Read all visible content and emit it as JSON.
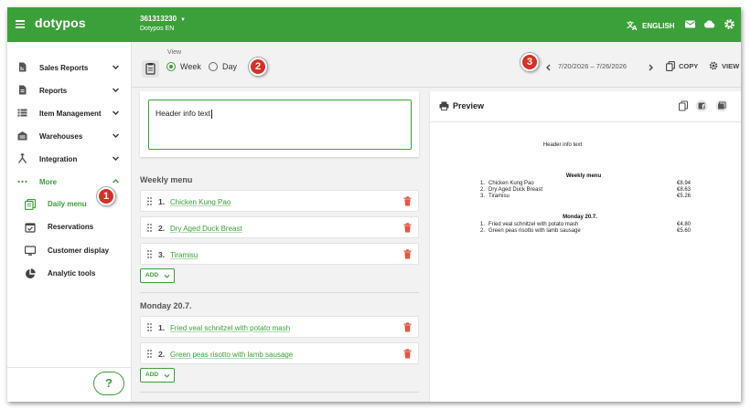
{
  "topbar": {
    "logo": "dotypos",
    "account_id": "361313230",
    "account_name": "Dotypos EN",
    "language": "ENGLISH",
    "color": "#3ba03a"
  },
  "sidebar": {
    "items": [
      {
        "label": "Sales Reports",
        "icon": "sales-report-icon"
      },
      {
        "label": "Reports",
        "icon": "report-icon"
      },
      {
        "label": "Item Management",
        "icon": "list-icon"
      },
      {
        "label": "Warehouses",
        "icon": "warehouse-icon"
      },
      {
        "label": "Integration",
        "icon": "integration-icon"
      },
      {
        "label": "More",
        "icon": "more-dots-icon"
      }
    ],
    "sub_items": [
      {
        "label": "Daily menu",
        "icon": "daily-menu-icon"
      },
      {
        "label": "Reservations",
        "icon": "calendar-check-icon"
      },
      {
        "label": "Customer display",
        "icon": "monitor-icon"
      },
      {
        "label": "Analytic tools",
        "icon": "pie-chart-icon"
      }
    ],
    "help": "?"
  },
  "badges": [
    "1",
    "2",
    "3"
  ],
  "toolbar": {
    "view_label": "View",
    "view_options": [
      "Week",
      "Day"
    ],
    "selected_view": "Week",
    "date_range": "7/20/2026 – 7/26/2026",
    "copy": "COPY",
    "view": "VIEW"
  },
  "editor": {
    "header_text": "Header info text",
    "sections": [
      {
        "title": "Weekly menu",
        "items": [
          {
            "num": "1.",
            "name": "Chicken Kung Pao"
          },
          {
            "num": "2.",
            "name": "Dry Aged Duck Breast"
          },
          {
            "num": "3.",
            "name": "Tiramisu"
          }
        ],
        "add": "ADD"
      },
      {
        "title": "Monday 20.7.",
        "items": [
          {
            "num": "1.",
            "name": "Fried veal schnitzel with potato mash"
          },
          {
            "num": "2.",
            "name": "Green peas risotto with lamb sausage"
          }
        ],
        "add": "ADD"
      }
    ]
  },
  "preview": {
    "title": "Preview",
    "header_text": "Header info text",
    "sections": [
      {
        "title": "Weekly menu",
        "rows": [
          {
            "num": "1.",
            "name": "Chicken Kung Pao",
            "price": "€8.94"
          },
          {
            "num": "2.",
            "name": "Dry Aged Duck Breast",
            "price": "€8.63"
          },
          {
            "num": "3.",
            "name": "Tiramisu",
            "price": "€5.26"
          }
        ]
      },
      {
        "title": "Monday 20.7.",
        "rows": [
          {
            "num": "1.",
            "name": "Fried veal schnitzel with potato mash",
            "price": "€4.80"
          },
          {
            "num": "2.",
            "name": "Green peas risotto with lamb sausage",
            "price": "€5.60"
          }
        ]
      }
    ]
  }
}
